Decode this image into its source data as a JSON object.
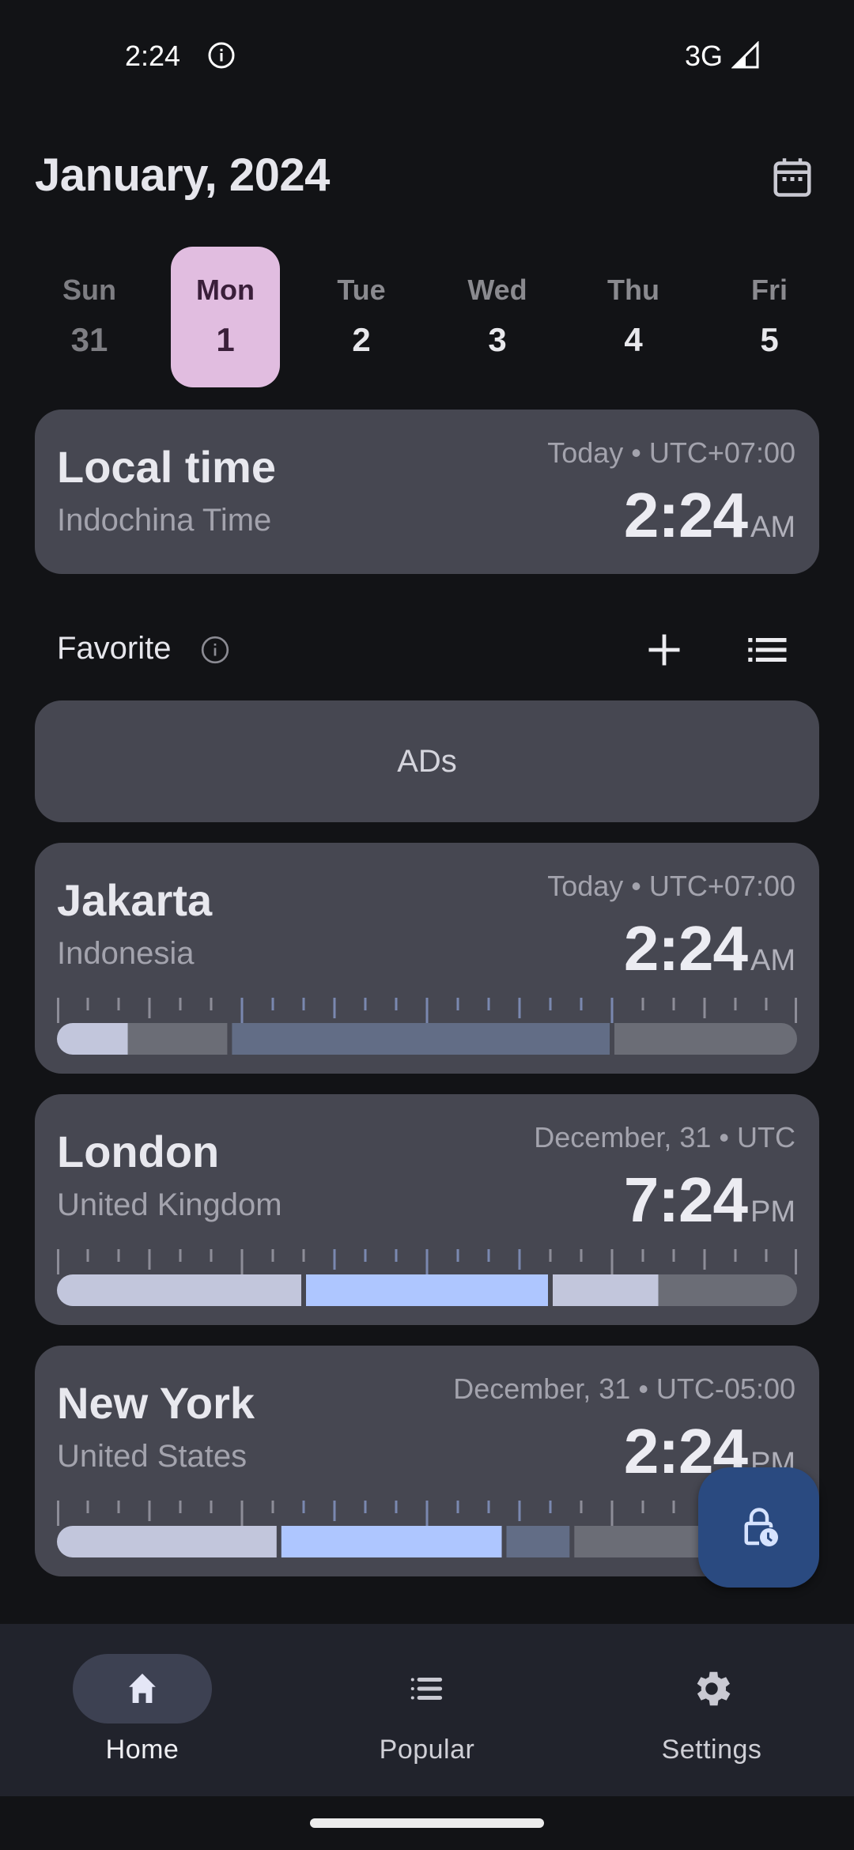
{
  "status_bar": {
    "time": "2:24",
    "network": "3G"
  },
  "header": {
    "title": "January, 2024",
    "calendar_icon": "calendar-icon"
  },
  "week": [
    {
      "name": "Sun",
      "num": "31",
      "state": "dim"
    },
    {
      "name": "Mon",
      "num": "1",
      "state": "selected"
    },
    {
      "name": "Tue",
      "num": "2",
      "state": "normal"
    },
    {
      "name": "Wed",
      "num": "3",
      "state": "normal"
    },
    {
      "name": "Thu",
      "num": "4",
      "state": "normal"
    },
    {
      "name": "Fri",
      "num": "5",
      "state": "normal"
    }
  ],
  "local": {
    "title": "Local time",
    "zone_name": "Indochina Time",
    "meta": "Today • UTC+07:00",
    "time": "2:24",
    "ampm": "AM"
  },
  "favorite": {
    "label": "Favorite",
    "add_icon": "plus-icon",
    "list_icon": "list-icon"
  },
  "ads": {
    "label": "ADs"
  },
  "colors": {
    "night": "#6b6d76",
    "early": "#c2c6dc",
    "work": "#aec6ff",
    "evening": "#626d86",
    "tick": "#8d8d98",
    "tick_hl": "#7a88b0",
    "divider": "#464751"
  },
  "cities": [
    {
      "city": "Jakarta",
      "country": "Indonesia",
      "meta": "Today • UTC+07:00",
      "time": "2:24",
      "ampm": "AM",
      "segments": [
        {
          "from": 0,
          "to": 2.3,
          "kind": "early"
        },
        {
          "from": 2.3,
          "to": 5.6,
          "kind": "night"
        },
        {
          "from": 5.6,
          "to": 18,
          "kind": "evening"
        },
        {
          "from": 18,
          "to": 24,
          "kind": "night"
        }
      ],
      "highlight_hours": [
        6,
        18
      ]
    },
    {
      "city": "London",
      "country": "United Kingdom",
      "meta": "December, 31 • UTC",
      "time": "7:24",
      "ampm": "PM",
      "segments": [
        {
          "from": 0,
          "to": 8,
          "kind": "early"
        },
        {
          "from": 8,
          "to": 16,
          "kind": "work"
        },
        {
          "from": 16,
          "to": 19.5,
          "kind": "early"
        },
        {
          "from": 19.5,
          "to": 24,
          "kind": "night"
        }
      ],
      "highlight_hours": [
        9,
        15
      ]
    },
    {
      "city": "New York",
      "country": "United States",
      "meta": "December, 31 • UTC-05:00",
      "time": "2:24",
      "ampm": "PM",
      "segments": [
        {
          "from": 0,
          "to": 7.2,
          "kind": "early"
        },
        {
          "from": 7.2,
          "to": 14.5,
          "kind": "work"
        },
        {
          "from": 14.5,
          "to": 16.7,
          "kind": "evening"
        },
        {
          "from": 16.7,
          "to": 24,
          "kind": "night"
        }
      ],
      "highlight_hours": [
        8,
        16
      ]
    }
  ],
  "fab": {
    "icon": "lock-clock-icon"
  },
  "nav": [
    {
      "label": "Home",
      "icon": "home-icon",
      "active": true
    },
    {
      "label": "Popular",
      "icon": "list-icon",
      "active": false
    },
    {
      "label": "Settings",
      "icon": "gear-icon",
      "active": false
    }
  ]
}
